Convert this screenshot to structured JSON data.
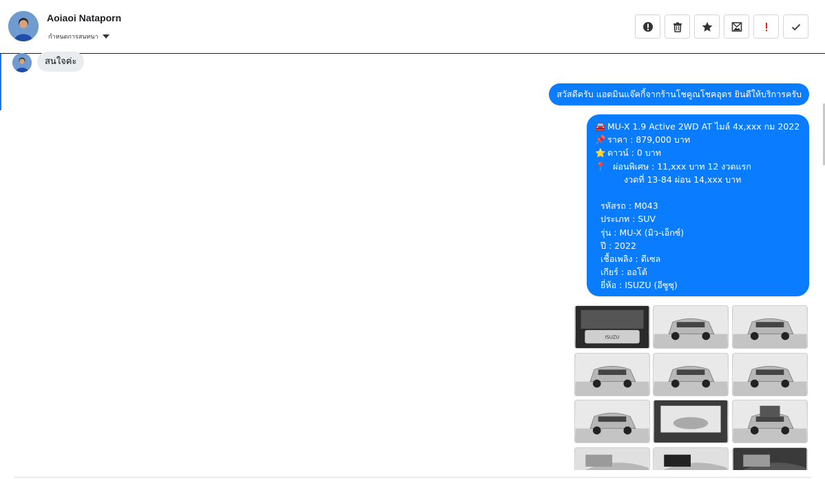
{
  "header": {
    "contact_name": "Aoiaoi Nataporn",
    "status_label": "กำหนดการสนทนา",
    "toolbar": [
      {
        "name": "alert-circle",
        "icon": "exclamation-circle-icon"
      },
      {
        "name": "delete",
        "icon": "trash-icon"
      },
      {
        "name": "star",
        "icon": "star-icon"
      },
      {
        "name": "mark-unread",
        "icon": "envelope-image-icon"
      },
      {
        "name": "important",
        "icon": "red-exclamation-icon"
      },
      {
        "name": "done",
        "icon": "checkmark-icon"
      }
    ]
  },
  "messages": {
    "incoming_1": "สนใจค่ะ",
    "outgoing_1": "สวัสดีครับ แอดมินแจ๊คกี้จากร้านโชคูณโชคอุดร ยินดีให้บริการครับ",
    "outgoing_2": {
      "lines": [
        {
          "emoji": "🚘",
          "text": "MU-X 1.9 Active 2WD AT ไมล์ 4x,xxx กม 2022"
        },
        {
          "emoji": "📌",
          "text": "ราคา : 879,000 บาท"
        },
        {
          "emoji": "⭐",
          "text": "ดาวน์ : 0 บาท"
        },
        {
          "emoji": "📍",
          "text": "ผ่อนพิเศษ : 11,xxx บาท 12 งวดแรก"
        },
        {
          "text": "งวดที่ 13-84 ผ่อน 14,xxx บาท"
        },
        {
          "text": "รหัสรถ : M043"
        },
        {
          "text": "ประเภท : SUV"
        },
        {
          "text": "รุ่น : MU-X (มิว-เอ็กซ์)"
        },
        {
          "text": "ปี : 2022"
        },
        {
          "text": "เชื้อเพลิง : ดีเซล"
        },
        {
          "text": "เกียร์ : ออโต้"
        },
        {
          "text": "ยี่ห้อ : ISUZU (อีซูซุ)"
        }
      ]
    }
  },
  "gallery": {
    "count": 12,
    "engine_badge": "ISUZU",
    "views": [
      "engine",
      "front-left",
      "front",
      "left",
      "rear-left",
      "rear",
      "left-rear",
      "side",
      "open-trunk",
      "fender",
      "door-interior",
      "cabin"
    ]
  },
  "colors": {
    "accent": "#0a7cff",
    "incoming_bg": "#e9ecef",
    "important": "#e02020"
  }
}
